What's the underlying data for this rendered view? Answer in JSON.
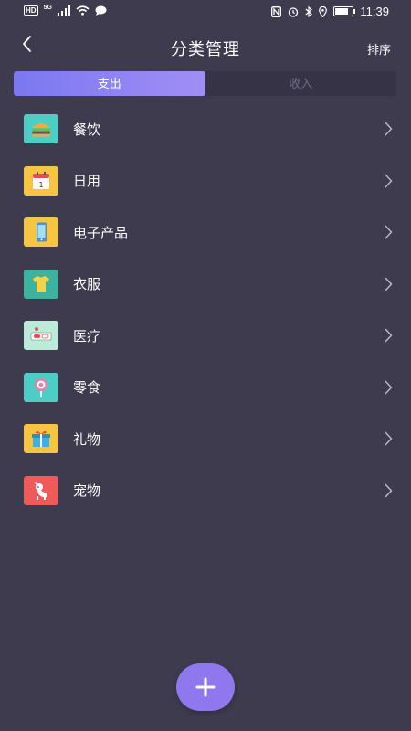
{
  "status_bar": {
    "hd": "HD",
    "network": "5G",
    "time": "11:39",
    "battery_level": 0.75
  },
  "header": {
    "title": "分类管理",
    "sort_label": "排序",
    "back_icon": "chevron-left-icon"
  },
  "tabs": [
    {
      "label": "支出",
      "active": true
    },
    {
      "label": "收入",
      "active": false
    }
  ],
  "categories": [
    {
      "label": "餐饮",
      "icon": "burger-icon",
      "color": "#4ecdc4"
    },
    {
      "label": "日用",
      "icon": "calendar-icon",
      "color": "#f6c544"
    },
    {
      "label": "电子产品",
      "icon": "phone-icon",
      "color": "#f6c544"
    },
    {
      "label": "衣服",
      "icon": "shirt-icon",
      "color": "#3bb39e"
    },
    {
      "label": "医疗",
      "icon": "pill-icon",
      "color": "#bdebd9"
    },
    {
      "label": "零食",
      "icon": "lollipop-icon",
      "color": "#4ecdc4"
    },
    {
      "label": "礼物",
      "icon": "gift-icon",
      "color": "#f6c544"
    },
    {
      "label": "宠物",
      "icon": "dog-icon",
      "color": "#ef5b5b"
    }
  ],
  "fab": {
    "icon": "plus-icon",
    "color": "#8f77ee"
  },
  "colors": {
    "background": "#3e3b4f",
    "accent": "#8f77ee"
  }
}
